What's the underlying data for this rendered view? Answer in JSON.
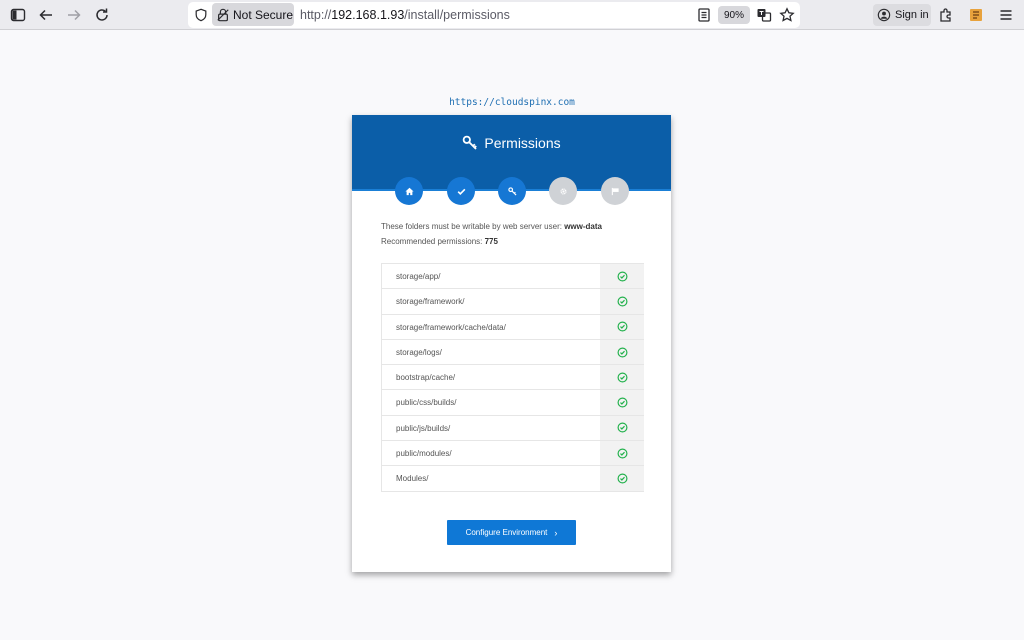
{
  "browser": {
    "security_label": "Not Secure",
    "url_prefix": "http://",
    "url_host": "192.168.1.93",
    "url_path": "/install/permissions",
    "zoom": "90%",
    "signin_label": "Sign in"
  },
  "page": {
    "site_link": "https://cloudspinx.com",
    "title": "Permissions",
    "info_line1_prefix": "These folders must be writable by web server user: ",
    "info_line1_user": "www-data",
    "info_line2_prefix": "Recommended permissions: ",
    "info_line2_value": "775",
    "steps": [
      {
        "icon": "home-icon",
        "state": "done"
      },
      {
        "icon": "check-icon",
        "state": "done"
      },
      {
        "icon": "key-icon",
        "state": "done"
      },
      {
        "icon": "gear-icon",
        "state": "todo"
      },
      {
        "icon": "flag-icon",
        "state": "todo"
      }
    ],
    "folders": [
      {
        "path": "storage/app/",
        "status": "ok"
      },
      {
        "path": "storage/framework/",
        "status": "ok"
      },
      {
        "path": "storage/framework/cache/data/",
        "status": "ok"
      },
      {
        "path": "storage/logs/",
        "status": "ok"
      },
      {
        "path": "bootstrap/cache/",
        "status": "ok"
      },
      {
        "path": "public/css/builds/",
        "status": "ok"
      },
      {
        "path": "public/js/builds/",
        "status": "ok"
      },
      {
        "path": "public/modules/",
        "status": "ok"
      },
      {
        "path": "Modules/",
        "status": "ok"
      }
    ],
    "button_label": "Configure Environment",
    "button_arrow": "›"
  },
  "colors": {
    "header": "#0b5ea8",
    "step_done": "#1677d4",
    "step_todo": "#cfd2d6",
    "ok": "#22b14c",
    "button": "#0f78d6"
  }
}
